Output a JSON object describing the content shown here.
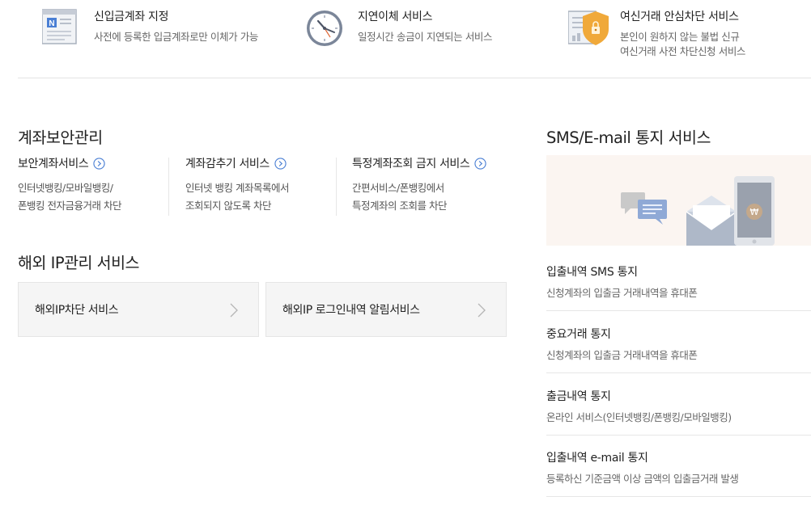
{
  "top_services": [
    {
      "icon": "account-book-icon",
      "title": "신입금계좌 지정",
      "desc": [
        "사전에 등록한 입금계좌로만 이체가 가능"
      ]
    },
    {
      "icon": "clock-icon",
      "title": "지연이체 서비스",
      "desc": [
        "일정시간 송금이 지연되는 서비스"
      ]
    },
    {
      "icon": "shield-lock-icon",
      "title": "여신거래 안심차단 서비스",
      "desc": [
        "본인이 원하지 않는 불법 신규",
        "여신거래 사전 차단신청 서비스"
      ]
    }
  ],
  "account_security": {
    "title": "계좌보안관리",
    "items": [
      {
        "title": "보안계좌서비스",
        "desc": [
          "인터넷뱅킹/모바일뱅킹/",
          "폰뱅킹 전자금융거래 차단"
        ]
      },
      {
        "title": "계좌감추기 서비스",
        "desc": [
          "인터넷 뱅킹 계좌목록에서",
          "조회되지 않도록 차단"
        ]
      },
      {
        "title": "특정계좌조회 금지 서비스",
        "desc": [
          "간편서비스/폰뱅킹에서",
          "특정계좌의 조회를 차단"
        ]
      }
    ]
  },
  "overseas_ip": {
    "title": "해외 IP관리 서비스",
    "items": [
      {
        "label": "해외IP차단 서비스"
      },
      {
        "label": "해외IP 로그인내역 알림서비스"
      }
    ]
  },
  "sms_email": {
    "title": "SMS/E-mail 통지 서비스",
    "items": [
      {
        "title": "입출내역 SMS 통지",
        "desc": "신청계좌의 입출금 거래내역을 휴대폰"
      },
      {
        "title": "중요거래 통지",
        "desc": "신청계좌의 입출금 거래내역을 휴대폰"
      },
      {
        "title": "출금내역 통지",
        "desc": "온라인 서비스(인터넷뱅킹/폰뱅킹/모바일뱅킹)"
      },
      {
        "title": "입출내역 e-mail 통지",
        "desc": "등록하신 기준금액 이상 금액의 입출금거래 발생"
      }
    ]
  },
  "colors": {
    "accent_blue": "#4a7fd4",
    "shield_orange": "#f0a93a",
    "banner_bg": "#fbf5f1"
  }
}
